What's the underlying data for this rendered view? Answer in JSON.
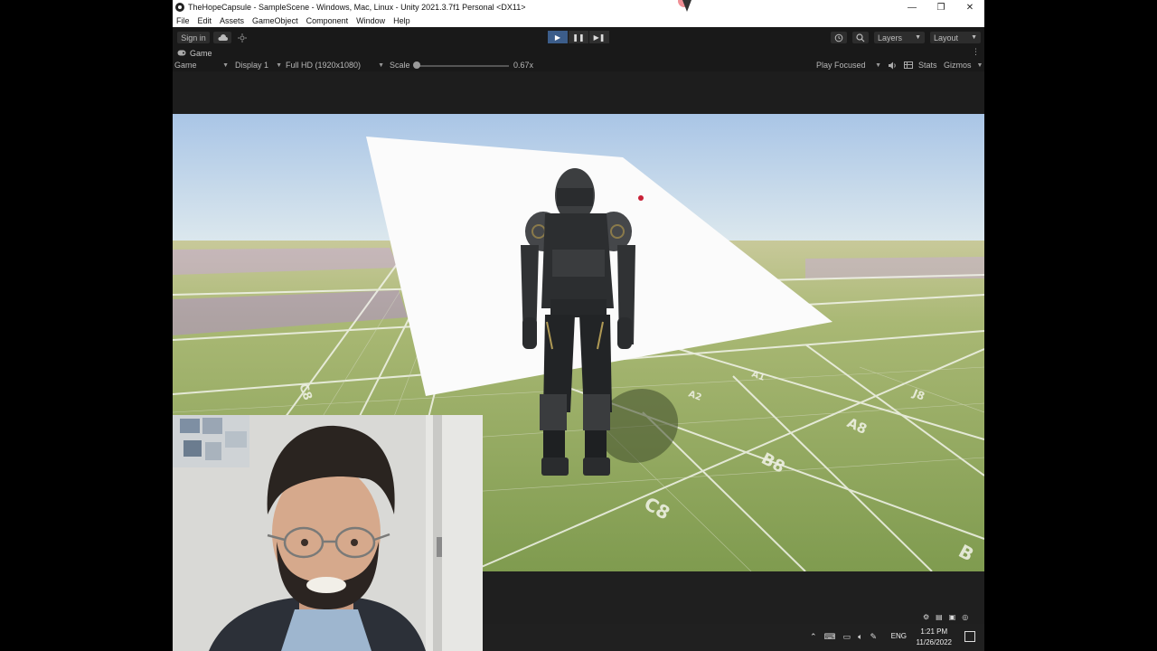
{
  "window": {
    "title": "TheHopeCapsule - SampleScene - Windows, Mac, Linux - Unity 2021.3.7f1 Personal <DX11>",
    "controls": [
      "—",
      "❐",
      "✕"
    ]
  },
  "menu": [
    "File",
    "Edit",
    "Assets",
    "GameObject",
    "Component",
    "Window",
    "Help"
  ],
  "toolbar": {
    "sign_in": "Sign in",
    "cloud_icon": "cloud-icon",
    "collab_icon": "collab-icon",
    "play": "▶",
    "pause": "❚❚",
    "step": "▶❚",
    "history_icon": "history-icon",
    "search_icon": "search-icon",
    "layers": "Layers",
    "layout": "Layout"
  },
  "game_tab": {
    "icon": "game-controller-icon",
    "label": "Game",
    "menu": "⋮"
  },
  "game_bar": {
    "mode": "Game",
    "display": "Display 1",
    "resolution": "Full HD (1920x1080)",
    "scale_label": "Scale",
    "scale_value": "0.67x",
    "scale_fraction": 0.02,
    "play_focused": "Play Focused",
    "mute_icon": "speaker-icon",
    "stats_icon": "stats-icon",
    "stats": "Stats",
    "gizmos": "Gizmos"
  },
  "scene": {
    "grid_labels": [
      "B8",
      "C8",
      "A8",
      "J8",
      "B",
      "C8",
      "A1",
      "A2"
    ],
    "colors": {
      "sky_top": "#aac6e6",
      "sky_bottom": "#dce8f0",
      "ground": "#8aa45a",
      "panel": "#fbfbfb"
    }
  },
  "taskbar": {
    "language": "ENG",
    "time": "1:21 PM",
    "date": "11/26/2022"
  }
}
